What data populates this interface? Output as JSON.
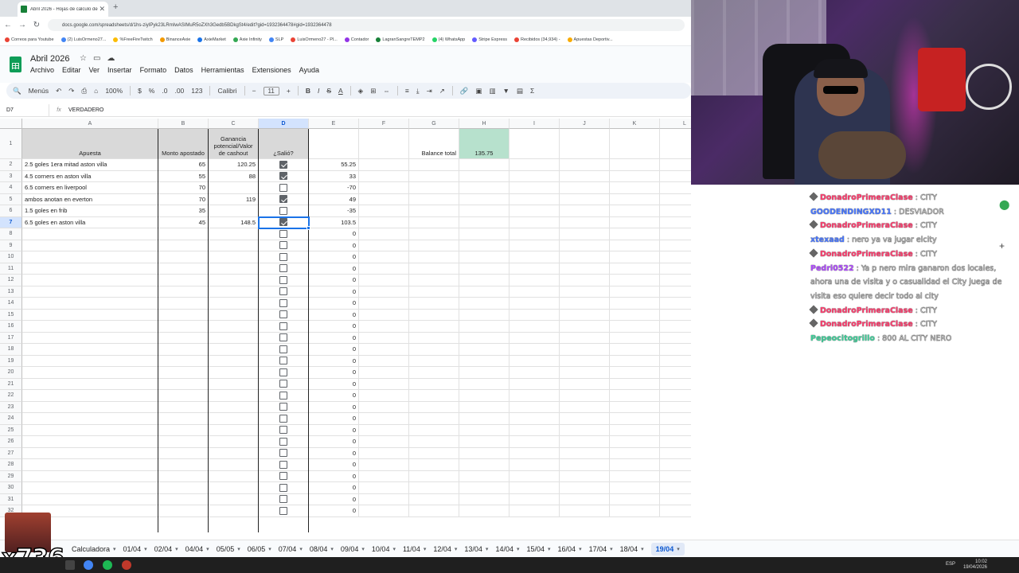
{
  "browser": {
    "tab_title": "Abril 2026 - Hojas de cálculo de",
    "tab_close": "✕",
    "new_tab": "+",
    "url": "docs.google.com/spreadsheets/d/1hs-ziyIPyk23LRmIwASIMuR5oZXh3Gedb5BDkgSt4/edit?gid=1932364478#gid=1932364478",
    "bookmarks": [
      "Correos para Youtube",
      "(2) LuisOrmeno27...",
      "%FreeFireTwitch",
      "BinanceAxie",
      "AxieMarket",
      "Axie Infinity",
      "SLP",
      "LuisOrmeno27 - Pl...",
      "Contador",
      "LagranSangreTEMP2",
      "(4) WhatsApp",
      "Stripe Express",
      "Recibidos (34,934) -",
      "Apuestas Deportiv..."
    ]
  },
  "sheets": {
    "doc_title": "Abril 2026",
    "menu": [
      "Archivo",
      "Editar",
      "Ver",
      "Insertar",
      "Formato",
      "Datos",
      "Herramientas",
      "Extensiones",
      "Ayuda"
    ],
    "toolbar": {
      "search": "Menús",
      "zoom": "100%",
      "currency": "$",
      "percent": "%",
      "dec_less": ".0",
      "dec_more": ".00",
      "fmt_123": "123",
      "font": "Calibri",
      "font_size": "11",
      "minus": "−",
      "plus": "+",
      "bold": "B",
      "italic": "I",
      "strike": "S",
      "textcolor": "A",
      "sum": "Σ"
    },
    "namebox": "D7",
    "formula": "VERDADERO",
    "columns": [
      "A",
      "B",
      "C",
      "D",
      "E",
      "F",
      "G",
      "H",
      "I",
      "J",
      "K",
      "L"
    ],
    "headers": {
      "A": "Apuesta",
      "B": "Monto apostado",
      "C": "Ganancia potencial/Valor de cashout",
      "D": "¿Salió?"
    },
    "balance_label": "Balance total",
    "balance_value": "135.75",
    "rows": [
      {
        "n": "2",
        "a": "2.5 goles 1era mitad aston villa",
        "b": "65",
        "c": "120.25",
        "d": true,
        "e": "55.25"
      },
      {
        "n": "3",
        "a": "4.5 corners en aston villa",
        "b": "55",
        "c": "88",
        "d": true,
        "e": "33"
      },
      {
        "n": "4",
        "a": "6.5 corners en liverpool",
        "b": "70",
        "c": "",
        "d": false,
        "e": "-70"
      },
      {
        "n": "5",
        "a": "ambos anotan en everton",
        "b": "70",
        "c": "119",
        "d": true,
        "e": "49"
      },
      {
        "n": "6",
        "a": "1.5 goles en frib",
        "b": "35",
        "c": "",
        "d": false,
        "e": "-35"
      },
      {
        "n": "7",
        "a": "6.5 goles en aston villa",
        "b": "45",
        "c": "148.5",
        "d": true,
        "e": "103.5"
      }
    ],
    "empty_rows": [
      "8",
      "9",
      "10",
      "11",
      "12",
      "13",
      "14",
      "15",
      "16",
      "17",
      "18",
      "19",
      "20",
      "21",
      "22",
      "23",
      "24",
      "25",
      "26",
      "27",
      "28",
      "29",
      "30",
      "31",
      "32"
    ],
    "empty_e": "0",
    "sheet_tabs": [
      "Calculadora",
      "01/04",
      "02/04",
      "04/04",
      "05/05",
      "06/05",
      "07/04",
      "08/04",
      "09/04",
      "10/04",
      "11/04",
      "12/04",
      "13/04",
      "14/04",
      "15/04",
      "16/04",
      "17/04",
      "18/04",
      "19/04"
    ],
    "active_tab": "19/04"
  },
  "chat": [
    {
      "user": "DonadroPrimeraClase",
      "color": "#ff3c6e",
      "badge": true,
      "text": "CITY"
    },
    {
      "user": "GOODENDINGXD11",
      "color": "#4a78ff",
      "badge": false,
      "text": "DESVIADOR"
    },
    {
      "user": "DonadroPrimeraClase",
      "color": "#ff3c6e",
      "badge": true,
      "text": "CITY"
    },
    {
      "user": "xtexaad",
      "color": "#4a78ff",
      "badge": false,
      "text": "nero ya va jugar elcity"
    },
    {
      "user": "DonadroPrimeraClase",
      "color": "#ff3c6e",
      "badge": true,
      "text": "CITY"
    },
    {
      "user": "Pedri0522",
      "color": "#b04bff",
      "badge": false,
      "text": "Ya p nero mira ganaron dos locales, ahora una de visita y o casualidad el City juega de visita eso quiere decir todo al city"
    },
    {
      "user": "DonadroPrimeraClase",
      "color": "#ff3c6e",
      "badge": true,
      "text": "CITY"
    },
    {
      "user": "DonadroPrimeraClase",
      "color": "#ff3c6e",
      "badge": true,
      "text": "CITY"
    },
    {
      "user": "Pepeocitogrillo",
      "color": "#3ecf9a",
      "badge": false,
      "text": "800 AL CITY NERO"
    }
  ],
  "overlay": {
    "multiplier": "x736"
  },
  "taskbar": {
    "lang": "ESP",
    "time": "10:02",
    "date": "19/04/2026"
  },
  "icons": {
    "star": "star-icon",
    "move": "move-icon",
    "cloud": "cloud-status-icon",
    "location": "location-pin-icon",
    "add": "plus-icon"
  },
  "colors": {
    "accent": "#1a73e8",
    "balance_bg": "#b7e1cd",
    "header_bg": "#d9d9d9"
  }
}
